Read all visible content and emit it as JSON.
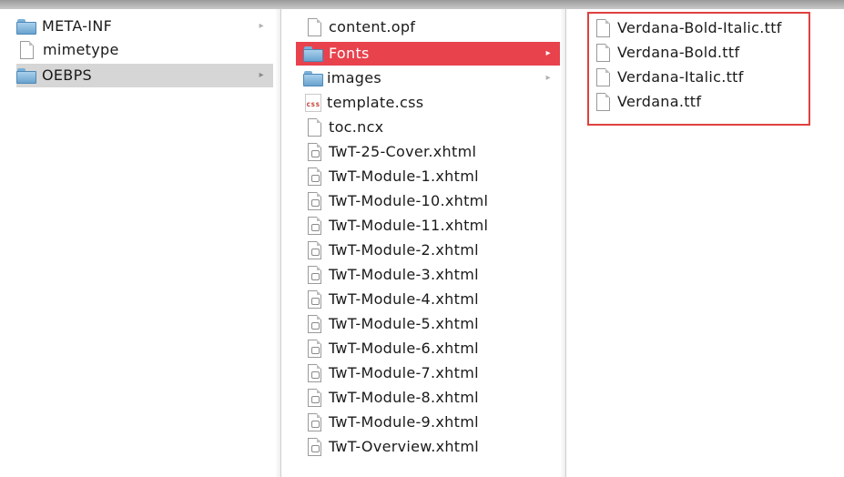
{
  "column1": {
    "items": [
      {
        "label": "META-INF",
        "icon": "folder-icon",
        "has_children": true
      },
      {
        "label": "mimetype",
        "icon": "document-icon",
        "has_children": false
      },
      {
        "label": "OEBPS",
        "icon": "folder-icon",
        "has_children": true,
        "selected": "inactive"
      }
    ]
  },
  "column2": {
    "items": [
      {
        "label": "content.opf",
        "icon": "document-icon"
      },
      {
        "label": "Fonts",
        "icon": "folder-icon",
        "selected": "active"
      },
      {
        "label": "images",
        "icon": "folder-icon"
      },
      {
        "label": "template.css",
        "icon": "css-file-icon",
        "icon_text": "css"
      },
      {
        "label": "toc.ncx",
        "icon": "document-icon"
      },
      {
        "label": "TwT-25-Cover.xhtml",
        "icon": "xhtml-file-icon"
      },
      {
        "label": "TwT-Module-1.xhtml",
        "icon": "xhtml-file-icon"
      },
      {
        "label": "TwT-Module-10.xhtml",
        "icon": "xhtml-file-icon"
      },
      {
        "label": "TwT-Module-11.xhtml",
        "icon": "xhtml-file-icon"
      },
      {
        "label": "TwT-Module-2.xhtml",
        "icon": "xhtml-file-icon"
      },
      {
        "label": "TwT-Module-3.xhtml",
        "icon": "xhtml-file-icon"
      },
      {
        "label": "TwT-Module-4.xhtml",
        "icon": "xhtml-file-icon"
      },
      {
        "label": "TwT-Module-5.xhtml",
        "icon": "xhtml-file-icon"
      },
      {
        "label": "TwT-Module-6.xhtml",
        "icon": "xhtml-file-icon"
      },
      {
        "label": "TwT-Module-7.xhtml",
        "icon": "xhtml-file-icon"
      },
      {
        "label": "TwT-Module-8.xhtml",
        "icon": "xhtml-file-icon"
      },
      {
        "label": "TwT-Module-9.xhtml",
        "icon": "xhtml-file-icon"
      },
      {
        "label": "TwT-Overview.xhtml",
        "icon": "xhtml-file-icon"
      }
    ]
  },
  "column3": {
    "items": [
      {
        "label": "Verdana-Bold-Italic.ttf",
        "icon": "document-icon"
      },
      {
        "label": "Verdana-Bold.ttf",
        "icon": "document-icon"
      },
      {
        "label": "Verdana-Italic.ttf",
        "icon": "document-icon"
      },
      {
        "label": "Verdana.ttf",
        "icon": "document-icon"
      }
    ]
  },
  "chevron_glyph": "▸",
  "colors": {
    "selection_active": "#e8424d",
    "selection_inactive": "#d6d6d6",
    "highlight_box": "#e0413f"
  }
}
